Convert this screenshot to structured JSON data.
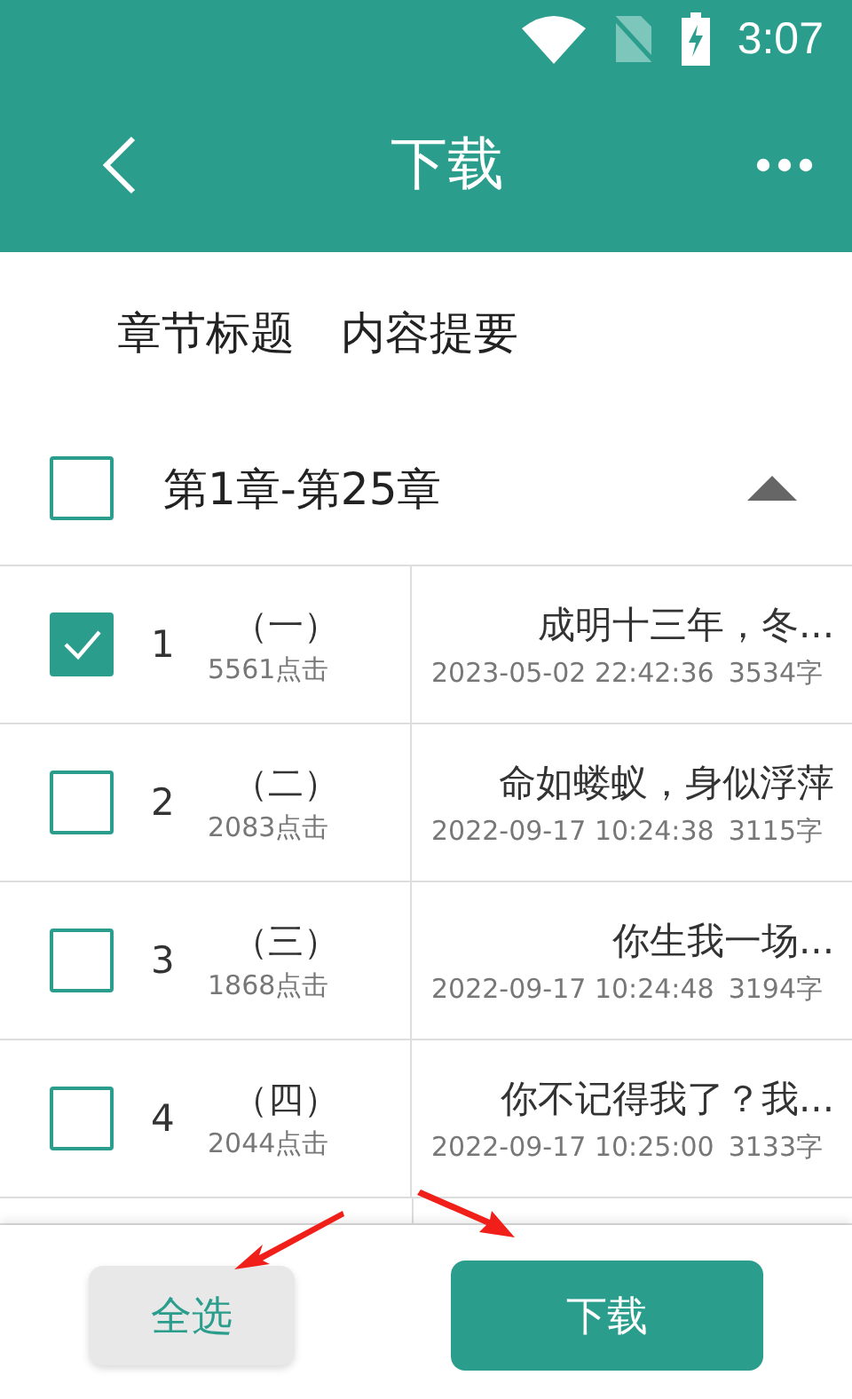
{
  "status_bar": {
    "time": "3:07"
  },
  "header": {
    "title": "下载"
  },
  "column_headers": [
    "章节标题",
    "内容提要"
  ],
  "group": {
    "label": "第1章-第25章",
    "checked": false,
    "expanded": true
  },
  "chapters": [
    {
      "number": "1",
      "title": "（一）",
      "clicks": "5561点击",
      "summary": "成明十三年，冬...",
      "date": "2023-05-02 22:42:36",
      "words": "3534字",
      "checked": true
    },
    {
      "number": "2",
      "title": "（二）",
      "clicks": "2083点击",
      "summary": "命如蝼蚁，身似浮萍",
      "date": "2022-09-17 10:24:38",
      "words": "3115字",
      "checked": false
    },
    {
      "number": "3",
      "title": "（三）",
      "clicks": "1868点击",
      "summary": "你生我一场...",
      "date": "2022-09-17 10:24:48",
      "words": "3194字",
      "checked": false
    },
    {
      "number": "4",
      "title": "（四）",
      "clicks": "2044点击",
      "summary": "你不记得我了？我...",
      "date": "2022-09-17 10:25:00",
      "words": "3133字",
      "checked": false
    }
  ],
  "buttons": {
    "select_all": "全选",
    "download": "下载"
  }
}
